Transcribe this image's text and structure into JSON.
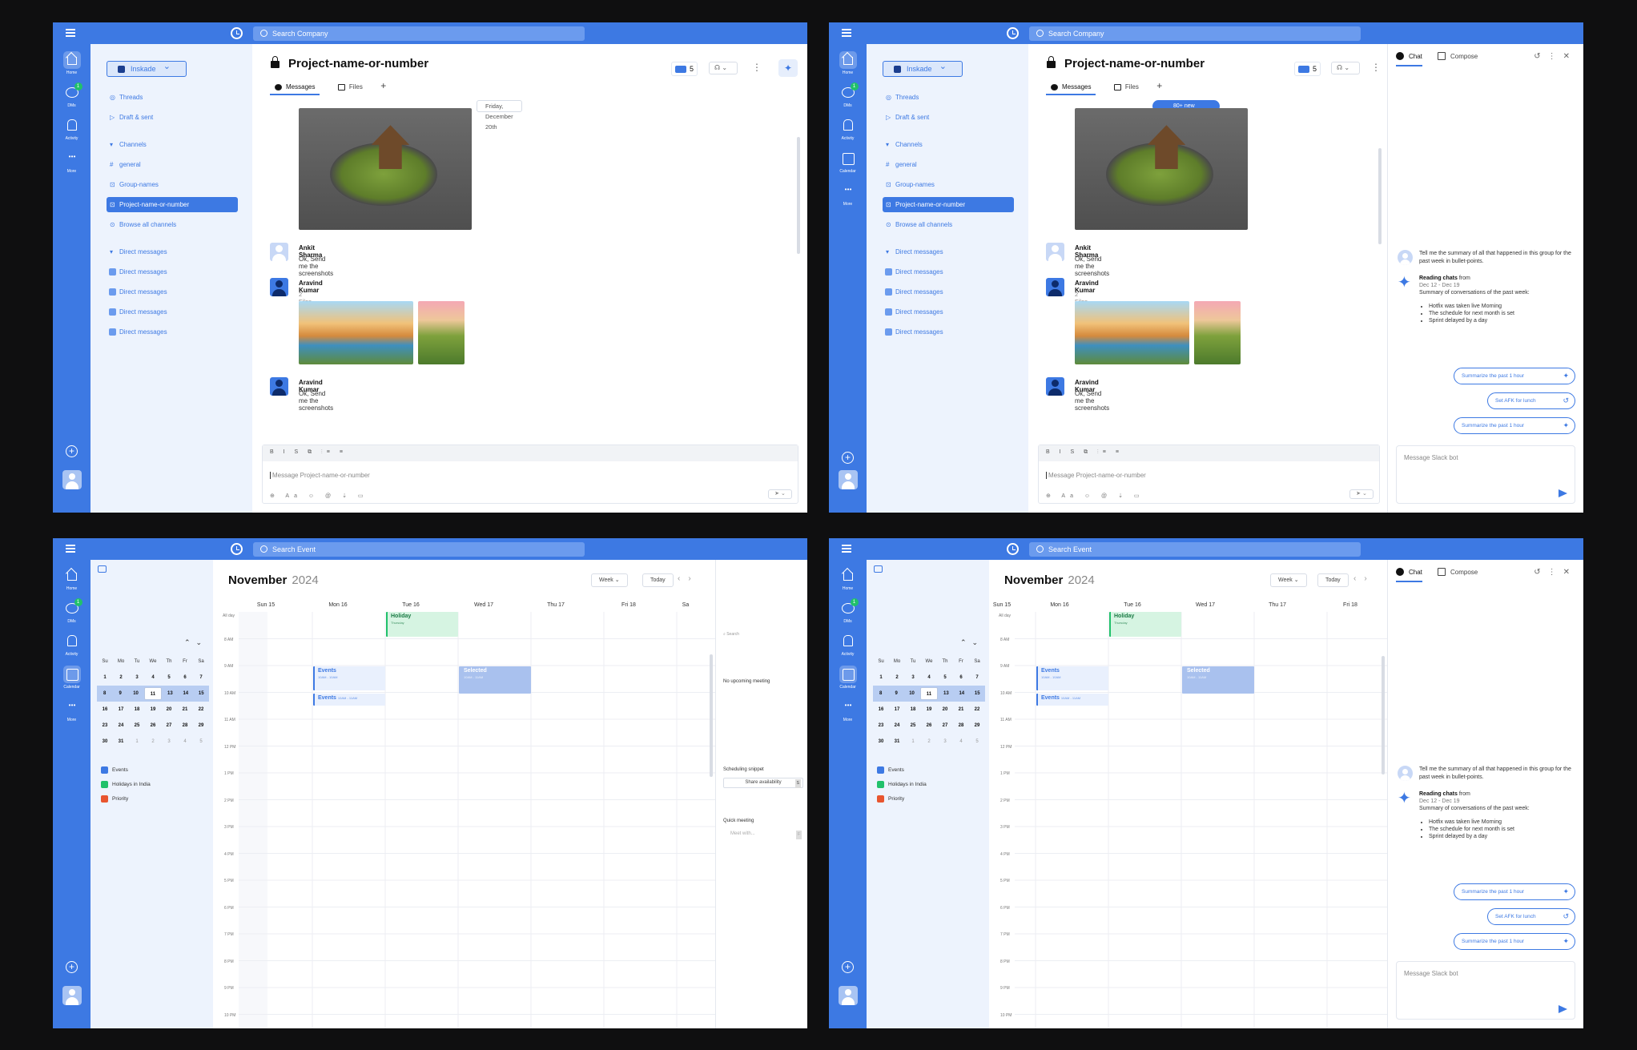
{
  "search": {
    "company": "Search Company",
    "event": "Search Event"
  },
  "rail": {
    "home": "Home",
    "dms": "DMs",
    "activity": "Activity",
    "calendar": "Calendar",
    "more": "More",
    "dm_badge": "1"
  },
  "sidebar": {
    "workspace": "Inskade",
    "threads": "Threads",
    "drafts": "Draft & sent",
    "channels_header": "Channels",
    "channels": [
      "general",
      "Group-names",
      "Project-name-or-number"
    ],
    "browse": "Browse all channels",
    "dm_header": "Direct messages",
    "dms": [
      "Direct messages",
      "Direct messages",
      "Direct messages",
      "Direct messages"
    ]
  },
  "channel": {
    "title": "Project-name-or-number",
    "member_count": "5",
    "tabs": [
      "Messages",
      "Files"
    ],
    "add_tab": "+",
    "date_pill": "Friday, December 20th",
    "new_messages": "80+ new messages"
  },
  "messages": [
    {
      "sender": "Ankit Sharma",
      "text": "Ok, Send me the screenshots"
    },
    {
      "sender": "Aravind Kumar",
      "files": "2 Files"
    },
    {
      "sender": "Aravind Kumar",
      "text": "Ok, Send me the screenshots"
    }
  ],
  "composer": {
    "placeholder": "Message Project-name-or-number",
    "format_tools": "B I S ⧉ ⋮≡ ≡"
  },
  "ai": {
    "tabs": [
      "Chat",
      "Compose"
    ],
    "question": "Tell me the summary of all that happened in this group for the past week in bullet-points.",
    "reading": "Reading chats",
    "reading_from": "from",
    "range": "Dec 12 - Dec 19",
    "summary_intro": "Summary of conversations of the past week:",
    "bullets": [
      "Hotfix was taken live Morning",
      "The schedule for next month is set",
      "Sprint delayed by a day"
    ],
    "suggestions": [
      "Summarize the past 1 hour",
      "Set AFK for lunch",
      "Summarize the past 1 hour"
    ],
    "placeholder": "Message Slack bot"
  },
  "calendar": {
    "month": "November",
    "year": "2024",
    "view": "Week",
    "today": "Today",
    "weekday_heads": [
      "Su",
      "Mo",
      "Tu",
      "We",
      "Th",
      "Fr",
      "Sa"
    ],
    "weeks": [
      [
        "",
        "",
        "",
        "",
        "",
        "1",
        "2"
      ],
      [
        "3",
        "4",
        "5",
        "6",
        "7",
        "8",
        "9"
      ],
      [
        "",
        "",
        "",
        "",
        "",
        "",
        ""
      ],
      [
        "",
        "",
        "",
        "",
        "",
        "",
        ""
      ],
      [
        "",
        "",
        "",
        "",
        "",
        "",
        ""
      ],
      [
        "",
        "",
        "",
        "",
        "",
        "",
        ""
      ]
    ],
    "mini_rows": [
      [
        "1",
        "2",
        "3",
        "4",
        "5",
        "6",
        "7"
      ],
      [
        "8",
        "9",
        "10",
        "11",
        "13",
        "14",
        "15"
      ],
      [
        "16",
        "17",
        "18",
        "19",
        "20",
        "21",
        "22"
      ],
      [
        "23",
        "24",
        "25",
        "26",
        "27",
        "28",
        "29"
      ],
      [
        "30",
        "31",
        "1",
        "2",
        "3",
        "4",
        "5"
      ]
    ],
    "legend": [
      "Events",
      "Holidays in India",
      "Priority"
    ],
    "legend_colors": [
      "#3d79e3",
      "#21c16b",
      "#e8552f"
    ],
    "days": [
      "Sun 15",
      "Mon 16",
      "Tue 16",
      "Wed 17",
      "Thu 17",
      "Fri 18",
      "Sa"
    ],
    "times": [
      "All day",
      "8 AM",
      "9 AM",
      "10 AM",
      "11 AM",
      "12 PM",
      "1 PM",
      "2 PM",
      "3 PM",
      "4 PM",
      "5 PM",
      "6 PM",
      "7 PM",
      "8 PM",
      "9 PM",
      "10 PM"
    ],
    "events": {
      "holiday": "Holiday",
      "holiday_sub": "Thursday",
      "events": "Events",
      "events_time": "10AM - 10AM",
      "events2": "Events",
      "events2_time": "10AM - 11AM",
      "selected": "Selected",
      "selected_time": "10AM - 11AM"
    },
    "right": {
      "search": "Search",
      "no_meeting": "No upcoming meeting",
      "snippet": "Scheduling snippet",
      "share": "Share availability",
      "quick": "Quick meeting",
      "meet_with": "Meet with..."
    }
  }
}
